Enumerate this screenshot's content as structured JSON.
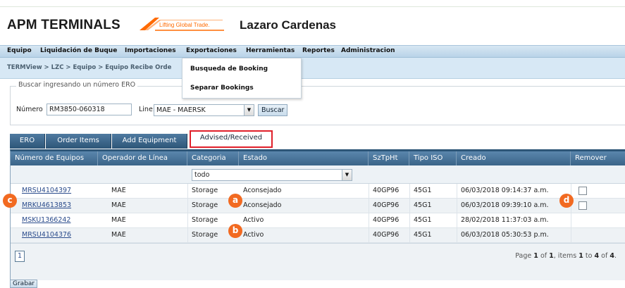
{
  "header": {
    "logo_text": "APM TERMINALS",
    "tagline": "Lifting Global Trade.",
    "terminal_name": "Lazaro Cardenas",
    "brand_color": "#ff6a00"
  },
  "menu": {
    "items": [
      "Equipo",
      "Liquidación de Buque",
      "Importaciones",
      "Exportaciones",
      "Herramientas",
      "Reportes",
      "Administracion"
    ],
    "open_dropdown": [
      "Busqueda de Booking",
      "Separar Bookings"
    ]
  },
  "breadcrumb": "TERMView > LZC > Equipo > Equipo Recibe Orde",
  "search": {
    "legend": "Buscar ingresando un número ERO",
    "numero_label": "Número",
    "numero_value": "RM3850-060318",
    "line_label": "Line:",
    "line_value": "MAE - MAERSK",
    "buscar_label": "Buscar"
  },
  "tabs": [
    {
      "label": "ERO",
      "active": false
    },
    {
      "label": "Order Items",
      "active": false
    },
    {
      "label": "Add Equipment",
      "active": false
    },
    {
      "label": "Advised/Received",
      "active": true
    }
  ],
  "grid": {
    "columns": [
      "Número de Equipos",
      "Operador de Línea",
      "Categoria",
      "Estado",
      "SzTpHt",
      "Tipo ISO",
      "Creado",
      "Remover"
    ],
    "filter_estado": "todo",
    "rows": [
      {
        "equipo": "MRSU4104397",
        "operador": "MAE",
        "categoria": "Storage",
        "estado": "Aconsejado",
        "sztpht": "40GP96",
        "iso": "45G1",
        "creado": "06/03/2018 09:14:37 a.m.",
        "remover": true
      },
      {
        "equipo": "MRKU4613853",
        "operador": "MAE",
        "categoria": "Storage",
        "estado": "Aconsejado",
        "sztpht": "40GP96",
        "iso": "45G1",
        "creado": "06/03/2018 09:39:10 a.m.",
        "remover": true
      },
      {
        "equipo": "MSKU1366242",
        "operador": "MAE",
        "categoria": "Storage",
        "estado": "Activo",
        "sztpht": "40GP96",
        "iso": "45G1",
        "creado": "28/02/2018 11:37:03 a.m.",
        "remover": false
      },
      {
        "equipo": "MRSU4104376",
        "operador": "MAE",
        "categoria": "Storage",
        "estado": "Activo",
        "sztpht": "40GP96",
        "iso": "45G1",
        "creado": "06/03/2018 05:30:53 p.m.",
        "remover": false
      }
    ],
    "page_number": "1",
    "page_info": {
      "page_word": "Page",
      "current": "1",
      "of_word": "of",
      "total": "1",
      "items_word": ", items",
      "from": "1",
      "to_word": "to",
      "to": "4",
      "of_word2": "of",
      "count": "4"
    }
  },
  "grabar_label": "Grabar",
  "callouts": {
    "a": "a",
    "b": "b",
    "c": "c",
    "d": "d"
  }
}
